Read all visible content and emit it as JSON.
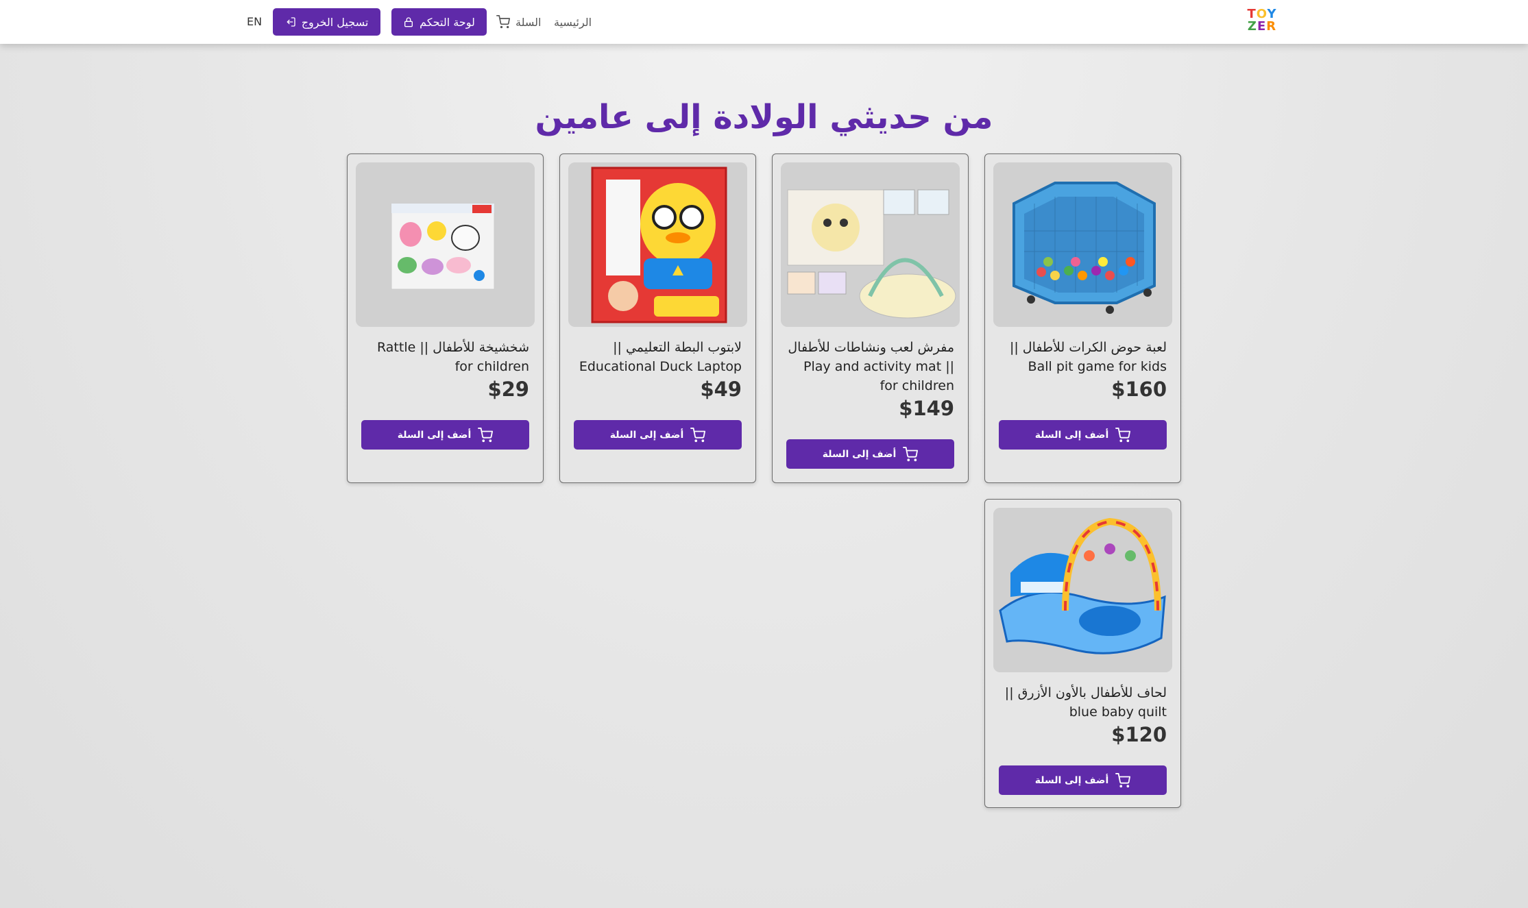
{
  "header": {
    "logo_line1": "TOY",
    "logo_line2": "ZER",
    "nav_home": "الرئيسية",
    "nav_cart": "السلة",
    "dashboard_button": "لوحة التحكم",
    "logout_button": "تسجيل الخروج",
    "language_toggle": "EN",
    "icons": {
      "cart": "cart-icon",
      "lock": "lock-icon",
      "logout": "logout-icon"
    }
  },
  "page": {
    "title": "من حديثي الولادة إلى عامين"
  },
  "products": [
    {
      "name": "لعبة حوض الكرات للأطفال || Ball pit game for kids",
      "price": "$160",
      "add_label": "أضف إلى السلة",
      "image": "ball-pit-image"
    },
    {
      "name": "مفرش لعب ونشاطات للأطفال || Play and activity mat for children",
      "price": "$149",
      "add_label": "أضف إلى السلة",
      "image": "play-mat-image"
    },
    {
      "name": "لابتوب البطة التعليمي || Educational Duck Laptop",
      "price": "$49",
      "add_label": "أضف إلى السلة",
      "image": "duck-laptop-image"
    },
    {
      "name": "شخشيخة للأطفال || Rattle for children",
      "price": "$29",
      "add_label": "أضف إلى السلة",
      "image": "rattle-image"
    },
    {
      "name": "لحاف للأطفال بالأون الأزرق || blue baby quilt",
      "price": "$120",
      "add_label": "أضف إلى السلة",
      "image": "baby-quilt-image"
    }
  ],
  "colors": {
    "accent": "#5f2aa9",
    "background": "#e6e6e6"
  }
}
